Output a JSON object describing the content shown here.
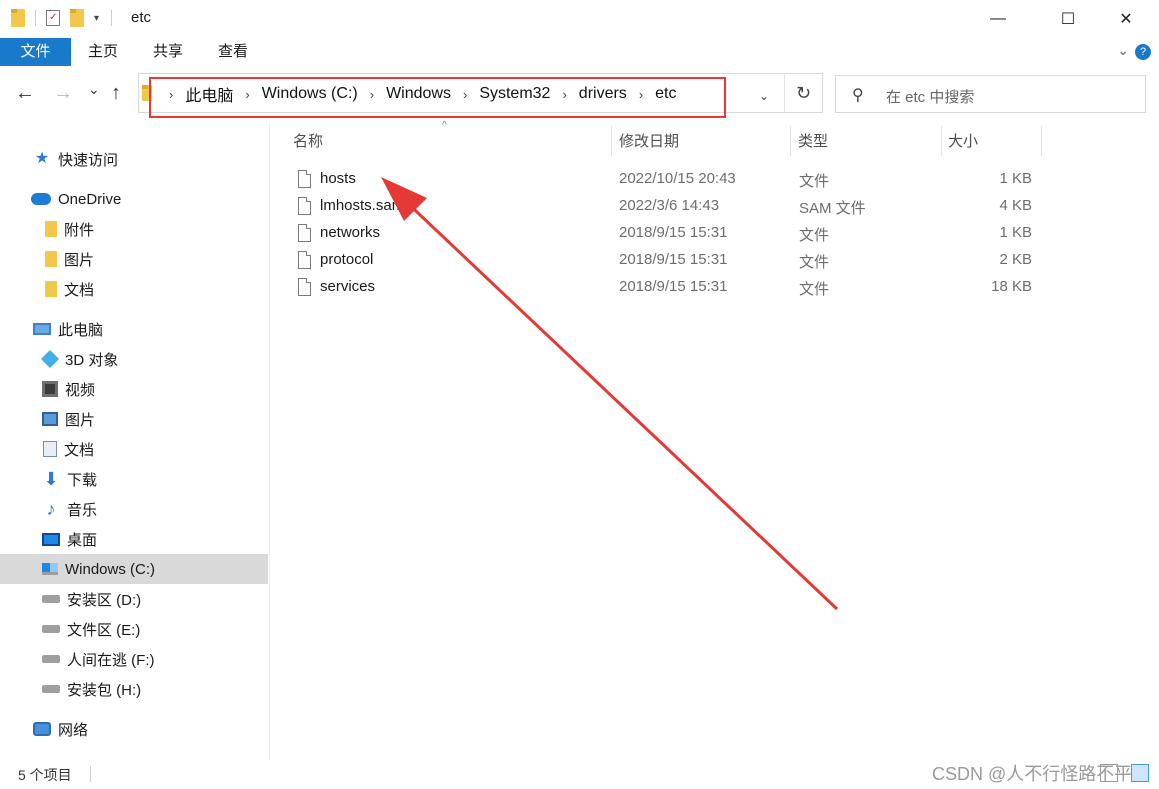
{
  "window": {
    "title": "etc",
    "minimize": "—",
    "maximize": "☐",
    "close": "✕"
  },
  "ribbon": {
    "tabs": [
      "文件",
      "主页",
      "共享",
      "查看"
    ],
    "expand_icon": "chevron-down-icon",
    "help_label": "?"
  },
  "nav": {
    "back": "←",
    "forward": "→",
    "recent": "⌄",
    "up": "↑"
  },
  "address": {
    "segments": [
      "此电脑",
      "Windows (C:)",
      "Windows",
      "System32",
      "drivers",
      "etc"
    ],
    "refresh": "↻",
    "dropdown": "⌄"
  },
  "search": {
    "placeholder": "在 etc 中搜索",
    "icon": "⚲"
  },
  "sidebar": {
    "items": [
      {
        "label": "快速访问",
        "icon": "star-icon"
      },
      {
        "label": "OneDrive",
        "icon": "cloud-icon"
      },
      {
        "label": "附件",
        "icon": "folder-icon"
      },
      {
        "label": "图片",
        "icon": "folder-icon"
      },
      {
        "label": "文档",
        "icon": "folder-icon"
      },
      {
        "label": "此电脑",
        "icon": "computer-icon"
      },
      {
        "label": "3D 对象",
        "icon": "cube-icon"
      },
      {
        "label": "视频",
        "icon": "video-icon"
      },
      {
        "label": "图片",
        "icon": "picture-icon"
      },
      {
        "label": "文档",
        "icon": "document-icon"
      },
      {
        "label": "下载",
        "icon": "download-icon"
      },
      {
        "label": "音乐",
        "icon": "music-icon"
      },
      {
        "label": "桌面",
        "icon": "desktop-icon"
      },
      {
        "label": "Windows (C:)",
        "icon": "windows-drive-icon",
        "selected": true
      },
      {
        "label": "安装区 (D:)",
        "icon": "drive-icon"
      },
      {
        "label": "文件区 (E:)",
        "icon": "drive-icon"
      },
      {
        "label": "人间在逃 (F:)",
        "icon": "drive-icon"
      },
      {
        "label": "安装包 (H:)",
        "icon": "drive-icon"
      },
      {
        "label": "网络",
        "icon": "network-icon"
      }
    ]
  },
  "columns": {
    "name": "名称",
    "date": "修改日期",
    "type": "类型",
    "size": "大小"
  },
  "files": [
    {
      "name": "hosts",
      "date": "2022/10/15 20:43",
      "type": "文件",
      "size": "1 KB"
    },
    {
      "name": "lmhosts.sam",
      "date": "2022/3/6 14:43",
      "type": "SAM 文件",
      "size": "4 KB"
    },
    {
      "name": "networks",
      "date": "2018/9/15 15:31",
      "type": "文件",
      "size": "1 KB"
    },
    {
      "name": "protocol",
      "date": "2018/9/15 15:31",
      "type": "文件",
      "size": "2 KB"
    },
    {
      "name": "services",
      "date": "2018/9/15 15:31",
      "type": "文件",
      "size": "18 KB"
    }
  ],
  "status": {
    "count": "5 个项目",
    "watermark": "CSDN @人不行怪路不平"
  },
  "colors": {
    "accent": "#1979ca",
    "highlight_box": "#e53935",
    "arrow": "#e53935"
  }
}
